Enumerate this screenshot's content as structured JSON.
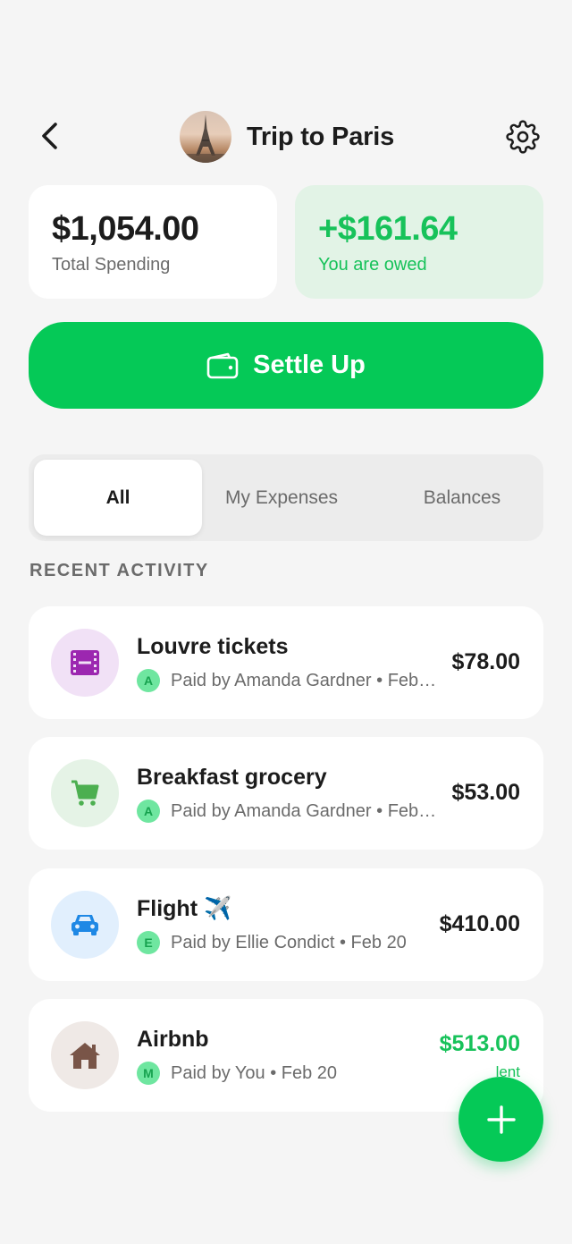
{
  "header": {
    "title": "Trip to Paris",
    "avatar_icon": "eiffel-tower-photo",
    "back_icon": "chevron-left-icon",
    "settings_icon": "gear-icon"
  },
  "summary": {
    "total_amount": "$1,054.00",
    "total_label": "Total Spending",
    "owed_amount": "+$161.64",
    "owed_label": "You are owed"
  },
  "settle": {
    "label": "Settle Up",
    "icon": "wallet-icon"
  },
  "tabs": [
    {
      "label": "All",
      "active": true
    },
    {
      "label": "My Expenses",
      "active": false
    },
    {
      "label": "Balances",
      "active": false
    }
  ],
  "recent_label": "RECENT ACTIVITY",
  "activities": [
    {
      "title": "Louvre tickets",
      "icon": "film-icon",
      "badge": "A",
      "meta": "Paid by Amanda Gardner • Feb…",
      "amount": "$78.00",
      "sub": ""
    },
    {
      "title": "Breakfast grocery",
      "icon": "shopping-cart-icon",
      "badge": "A",
      "meta": "Paid by Amanda Gardner • Feb…",
      "amount": "$53.00",
      "sub": ""
    },
    {
      "title": "Flight ✈️",
      "icon": "car-icon",
      "badge": "E",
      "meta": "Paid by Ellie Condict • Feb 20",
      "amount": "$410.00",
      "sub": ""
    },
    {
      "title": "Airbnb",
      "icon": "house-icon",
      "badge": "M",
      "meta": "Paid by You • Feb 20",
      "amount": "$513.00",
      "sub": "lent"
    }
  ],
  "colors": {
    "accent": "#05c957",
    "owed_green": "#17c25a",
    "owed_card_bg": "#e2f3e6",
    "film_bg": "#f1e1f6",
    "film_fg": "#9c27b0",
    "cart_bg": "#e5f3e6",
    "cart_fg": "#4caf50",
    "car_bg": "#e1effd",
    "car_fg": "#1e88e5",
    "house_bg": "#efe9e6",
    "house_fg": "#795548"
  },
  "fab_icon": "plus-icon"
}
